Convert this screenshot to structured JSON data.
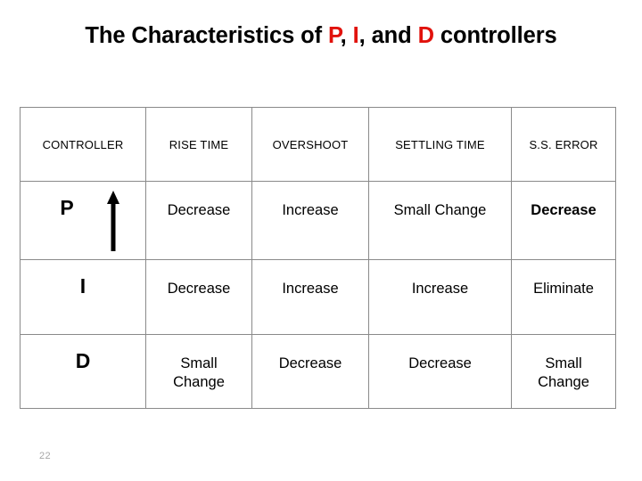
{
  "title": {
    "prefix": "The Characteristics of ",
    "p": "P",
    "sep1": ", ",
    "i": "I",
    "sep2": ", and ",
    "d": "D",
    "suffix": " controllers",
    "accent_color": "#e1120c"
  },
  "table": {
    "headers": [
      "CONTROLLER",
      "RISE  TIME",
      "OVERSHOOT",
      "SETTLING  TIME",
      "S.S. ERROR"
    ],
    "rows": [
      {
        "controller": "P",
        "has_arrow": true,
        "arrow_icon": "arrow-up-icon",
        "rise_time": "Decrease",
        "overshoot": "Increase",
        "settling_time": "Small Change",
        "ss_error": "Decrease",
        "ss_error_bold": true
      },
      {
        "controller": "I",
        "has_arrow": false,
        "rise_time": "Decrease",
        "overshoot": "Increase",
        "settling_time": "Increase",
        "ss_error": "Eliminate",
        "ss_error_bold": false
      },
      {
        "controller": "D",
        "has_arrow": false,
        "rise_time": "Small\nChange",
        "overshoot": "Decrease",
        "settling_time": "Decrease",
        "ss_error": "Small\nChange",
        "ss_error_bold": false
      }
    ]
  },
  "footer": {
    "page_number": "22"
  }
}
